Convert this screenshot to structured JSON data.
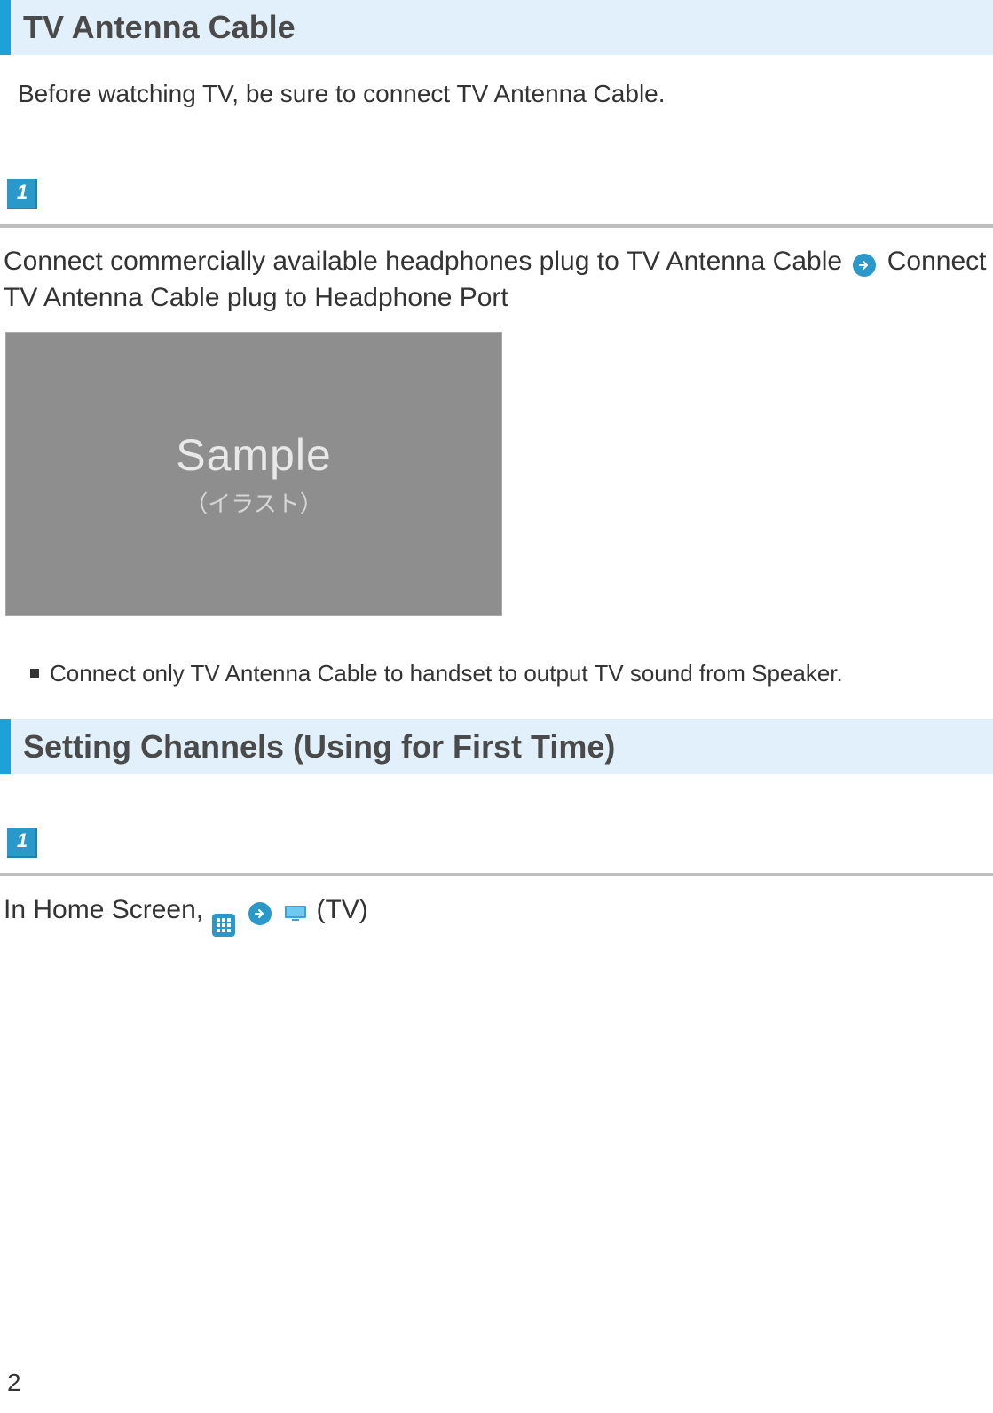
{
  "section1": {
    "title": "TV Antenna Cable",
    "intro": "Before watching TV, be sure to connect TV Antenna Cable.",
    "step1": {
      "number": "1",
      "text_a": "Connect commercially available headphones plug to TV Antenna Cable",
      "text_b": "Connect TV Antenna Cable plug to Headphone Port",
      "sample_label": "Sample",
      "sample_sub": "（イラスト）",
      "bullet": "Connect only TV Antenna Cable to handset to output TV sound from Speaker."
    }
  },
  "section2": {
    "title": "Setting Channels (Using for First Time)",
    "step1": {
      "number": "1",
      "text_a": "In Home Screen, ",
      "tv_label": " (TV)"
    }
  },
  "page_number": "2"
}
